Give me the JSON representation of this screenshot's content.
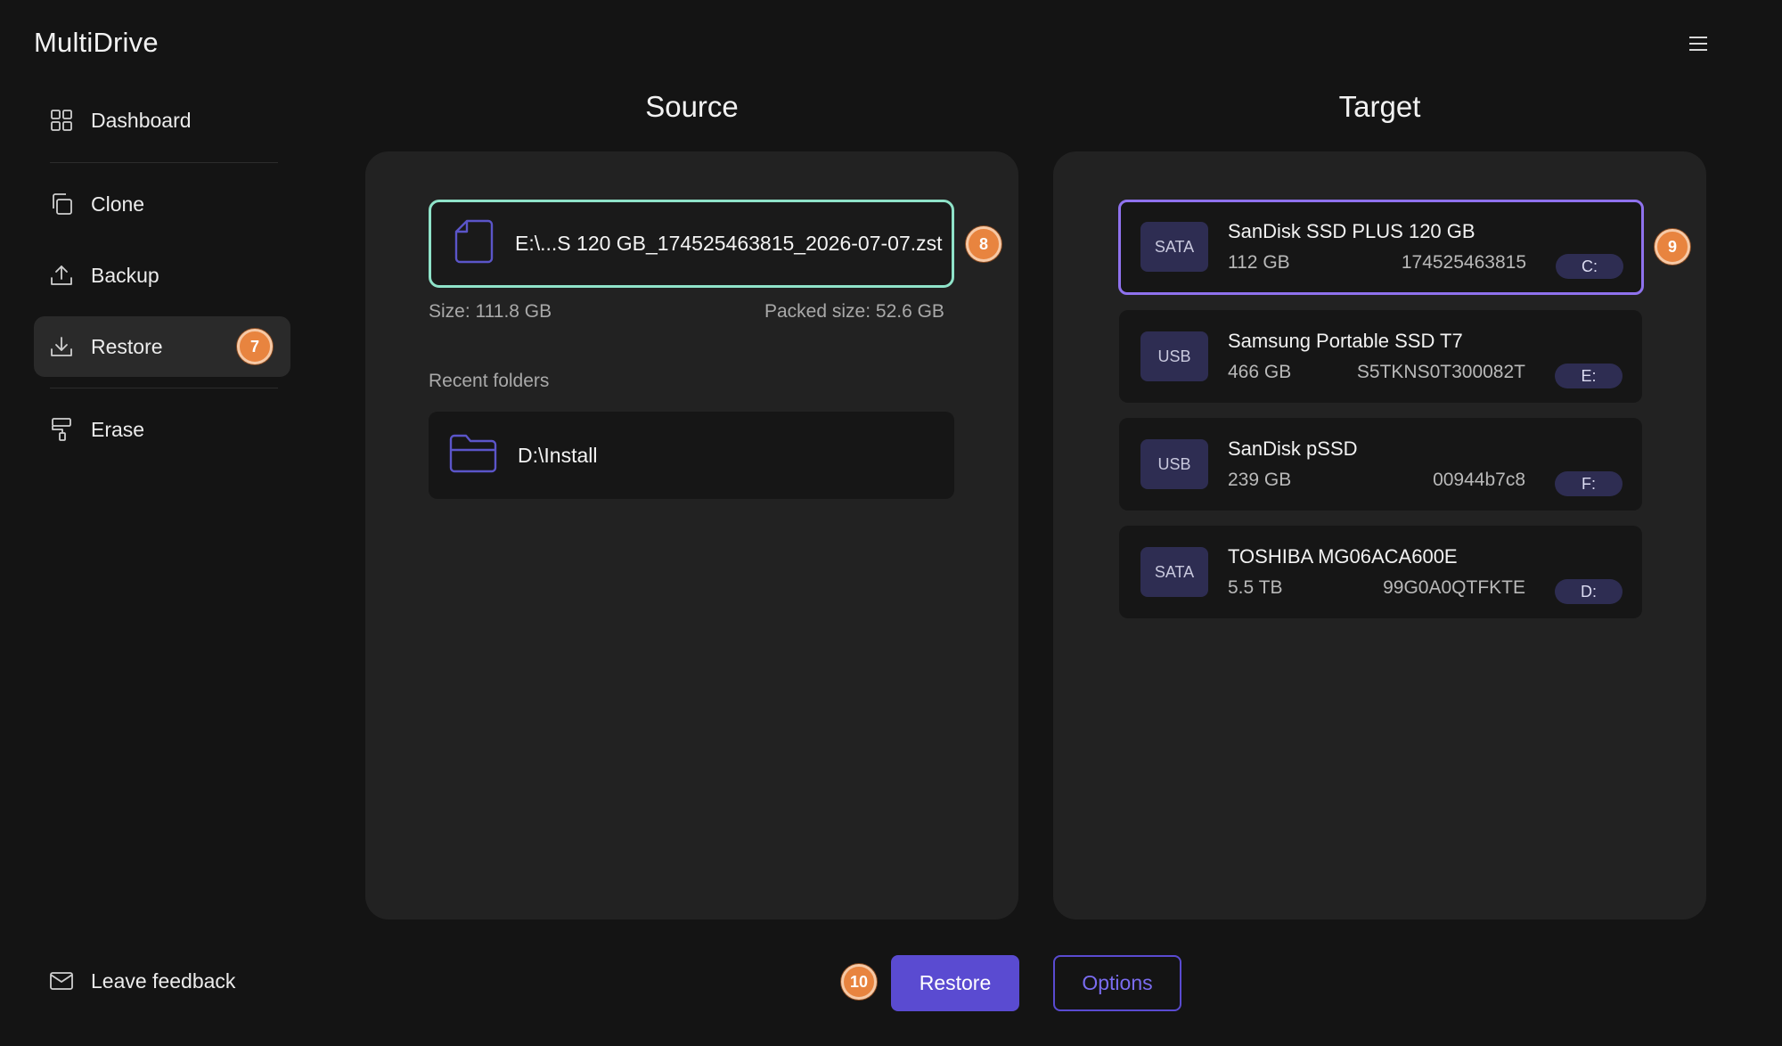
{
  "app": {
    "title": "MultiDrive"
  },
  "sidebar": {
    "items": [
      {
        "label": "Dashboard",
        "icon": "dashboard-icon"
      },
      {
        "label": "Clone",
        "icon": "clone-icon"
      },
      {
        "label": "Backup",
        "icon": "upload-icon"
      },
      {
        "label": "Restore",
        "icon": "download-icon",
        "active": true,
        "badge": "7"
      },
      {
        "label": "Erase",
        "icon": "paint-roller-icon"
      }
    ],
    "feedback": {
      "label": "Leave feedback",
      "icon": "mail-icon"
    }
  },
  "source": {
    "title": "Source",
    "file": {
      "name": "E:\\...S 120 GB_174525463815_2026-07-07.zst",
      "badge": "8"
    },
    "size": "Size: 111.8 GB",
    "packed_size": "Packed size: 52.6 GB",
    "recent_label": "Recent folders",
    "recent_folders": [
      {
        "path": "D:\\Install"
      }
    ]
  },
  "target": {
    "title": "Target",
    "badge": "9",
    "drives": [
      {
        "type": "SATA",
        "name": "SanDisk SSD PLUS 120 GB",
        "size": "112 GB",
        "serial": "174525463815",
        "letter": "C:",
        "selected": true
      },
      {
        "type": "USB",
        "name": "Samsung Portable SSD T7",
        "size": "466 GB",
        "serial": "S5TKNS0T300082T",
        "letter": "E:"
      },
      {
        "type": "USB",
        "name": "SanDisk pSSD",
        "size": "239 GB",
        "serial": "00944b7c8",
        "letter": "F:"
      },
      {
        "type": "SATA",
        "name": "TOSHIBA MG06ACA600E",
        "size": "5.5 TB",
        "serial": "99G0A0QTFKTE",
        "letter": "D:"
      }
    ]
  },
  "actions": {
    "restore_label": "Restore",
    "options_label": "Options",
    "badge": "10"
  },
  "colors": {
    "accent": "#5a4bd1",
    "source_border": "#8fe3c9",
    "target_border": "#8f72ee",
    "badge": "#e8843f"
  }
}
